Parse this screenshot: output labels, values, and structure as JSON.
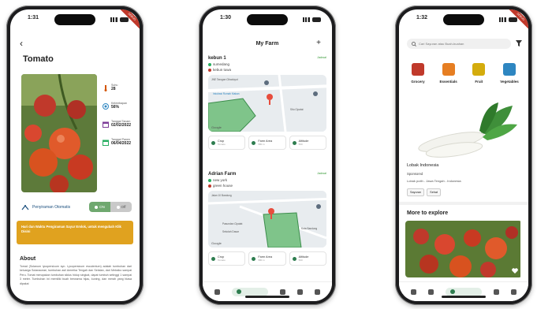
{
  "phones": [
    {
      "time": "1:31",
      "ribbon": "DEBUG",
      "back_glyph": "‹",
      "title": "Tomato",
      "stats": [
        {
          "label": "Suhu",
          "value": "28"
        },
        {
          "label": "Kelembapan",
          "value": "56%"
        },
        {
          "label": "Tanggal Tanam",
          "value": "02/02/2022"
        },
        {
          "label": "Tanggal Panen",
          "value": "06/04/2022"
        }
      ],
      "irrigation_label": "Penyiraman Otomatis",
      "toggle_on": "ON",
      "toggle_off": "Off",
      "alert": "Hari dan Waktu Pengiraman Sayur Emlok, untuk mengubah Klik Disini",
      "about_title": "About",
      "about_text": "Tomat (Solanum lycopersicum syn. Lycopersicum esculentum) adalah tumbuhan dari keluarga Solanaceae, tumbuhan asli Amerika Tengah dan Selatan, dari Meksiko sampai Peru. Tomat merupakan tumbuhan siklus hidup singkat, dapat tumbuh setinggi 1 sampai 3 meter. Tumbuhan ini memiliki buah berwarna hijau, kuning, dan merah yang biasa dipakai"
    },
    {
      "time": "1:30",
      "header": "My Farm",
      "plus": "+",
      "farms": [
        {
          "name": "kebun 1",
          "schedule": "Jadwal",
          "city": "sumedang",
          "place": "kebun tuwa",
          "chips": [
            {
              "label": "Crop",
              "value": "Tomato"
            },
            {
              "label": "Farm Area",
              "value": "580 m"
            },
            {
              "label": "Altitude",
              "value": "500"
            }
          ]
        },
        {
          "name": "Adrian Farm",
          "schedule": "Jadwal",
          "city": "new york",
          "place": "green house",
          "chips": [
            {
              "label": "Crop",
              "value": "Tomato"
            },
            {
              "label": "Farm Area",
              "value": "580 m"
            },
            {
              "label": "Altitude",
              "value": "500"
            }
          ]
        }
      ],
      "map_labels": [
        "JNE Tarogan Cibaduyut",
        "Inkubasi Rumah Makan",
        "Situ Cipatat",
        "Google",
        "Jalan 10 Bandung",
        "Pasundan Cipatat",
        "Sekolah Dasar",
        "Kota Bandung"
      ]
    },
    {
      "time": "1:32",
      "ribbon": "DEBUG",
      "search_placeholder": "Cari Sayuran atau Buah-buahan",
      "categories": [
        {
          "name": "Grocery",
          "color": "#c0392b"
        },
        {
          "name": "Essentials",
          "color": "#e67e22"
        },
        {
          "name": "Fruit",
          "color": "#d4ac0d"
        },
        {
          "name": "Vegetables",
          "color": "#2e86c1"
        }
      ],
      "product_name": "Lobak Indonesia",
      "sponsored": "Sponsored",
      "product_desc": "Lobak putih - Jawa Tengah - Indonesia",
      "tags": [
        "Sayuran",
        "Sehat"
      ],
      "more_title": "More to explore"
    }
  ],
  "colors": {
    "green": "#2e7d4f",
    "amber": "#e0a21f",
    "red": "#c0392b"
  }
}
